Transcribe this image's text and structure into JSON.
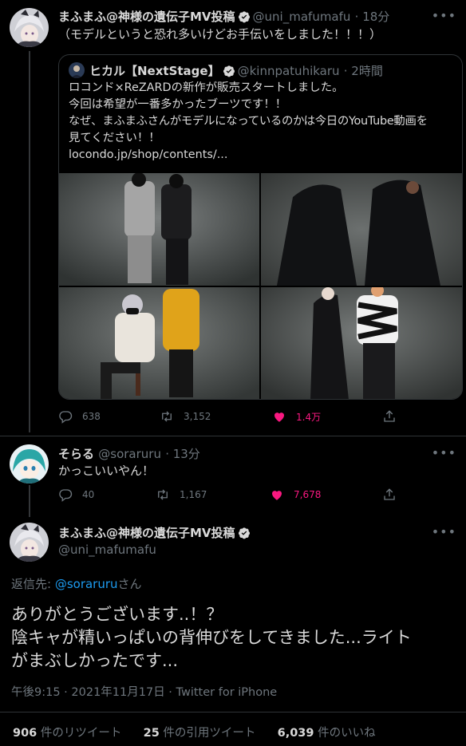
{
  "tweet1": {
    "name": "まふまふ@神様の遺伝子MV投稿",
    "handle": "@uni_mafumafu",
    "time": "· 18分",
    "text": "（モデルというと恐れ多いけどお手伝いをしました！！！）",
    "quote": {
      "name": "ヒカル【NextStage】",
      "handle": "@kinnpatuhikaru",
      "time": "· 2時間",
      "lines": [
        "ロコンド×ReZARDの新作が販売スタートしました。",
        "今回は希望が一番多かったブーツです！！",
        "なぜ、まふまふさんがモデルになっているのかは今日のYouTube動画を",
        "見てください！！",
        "locondo.jp/shop/contents/..."
      ]
    },
    "replies": "638",
    "retweets": "3,152",
    "likes": "1.4万"
  },
  "tweet2": {
    "name": "そらる",
    "handle": "@soraruru",
    "time": "· 13分",
    "text": "かっこいいやん！",
    "replies": "40",
    "retweets": "1,167",
    "likes": "7,678"
  },
  "main": {
    "name": "まふまふ@神様の遺伝子MV投稿",
    "handle": "@uni_mafumafu",
    "reply_prefix": "返信先: ",
    "reply_to": "@soraruru",
    "reply_suffix": "さん",
    "lines": [
      "ありがとうございます..！？",
      "陰キャが精いっぱいの背伸びをしてきました...ライト",
      "がまぶしかったです..."
    ],
    "meta": "午後9:15 · 2021年11月17日 · Twitter for iPhone",
    "stats": {
      "retweets_count": "906",
      "retweets_label": " 件のリツイート",
      "quotes_count": "25",
      "quotes_label": " 件の引用ツイート",
      "likes_count": "6,039",
      "likes_label": " 件のいいね"
    }
  },
  "colors": {
    "accent": "#1d9bf0",
    "like": "#f91880",
    "muted": "#6e767d"
  },
  "icons": [
    "verified-badge-icon",
    "reply-icon",
    "retweet-icon",
    "like-icon",
    "share-icon",
    "more-icon"
  ]
}
